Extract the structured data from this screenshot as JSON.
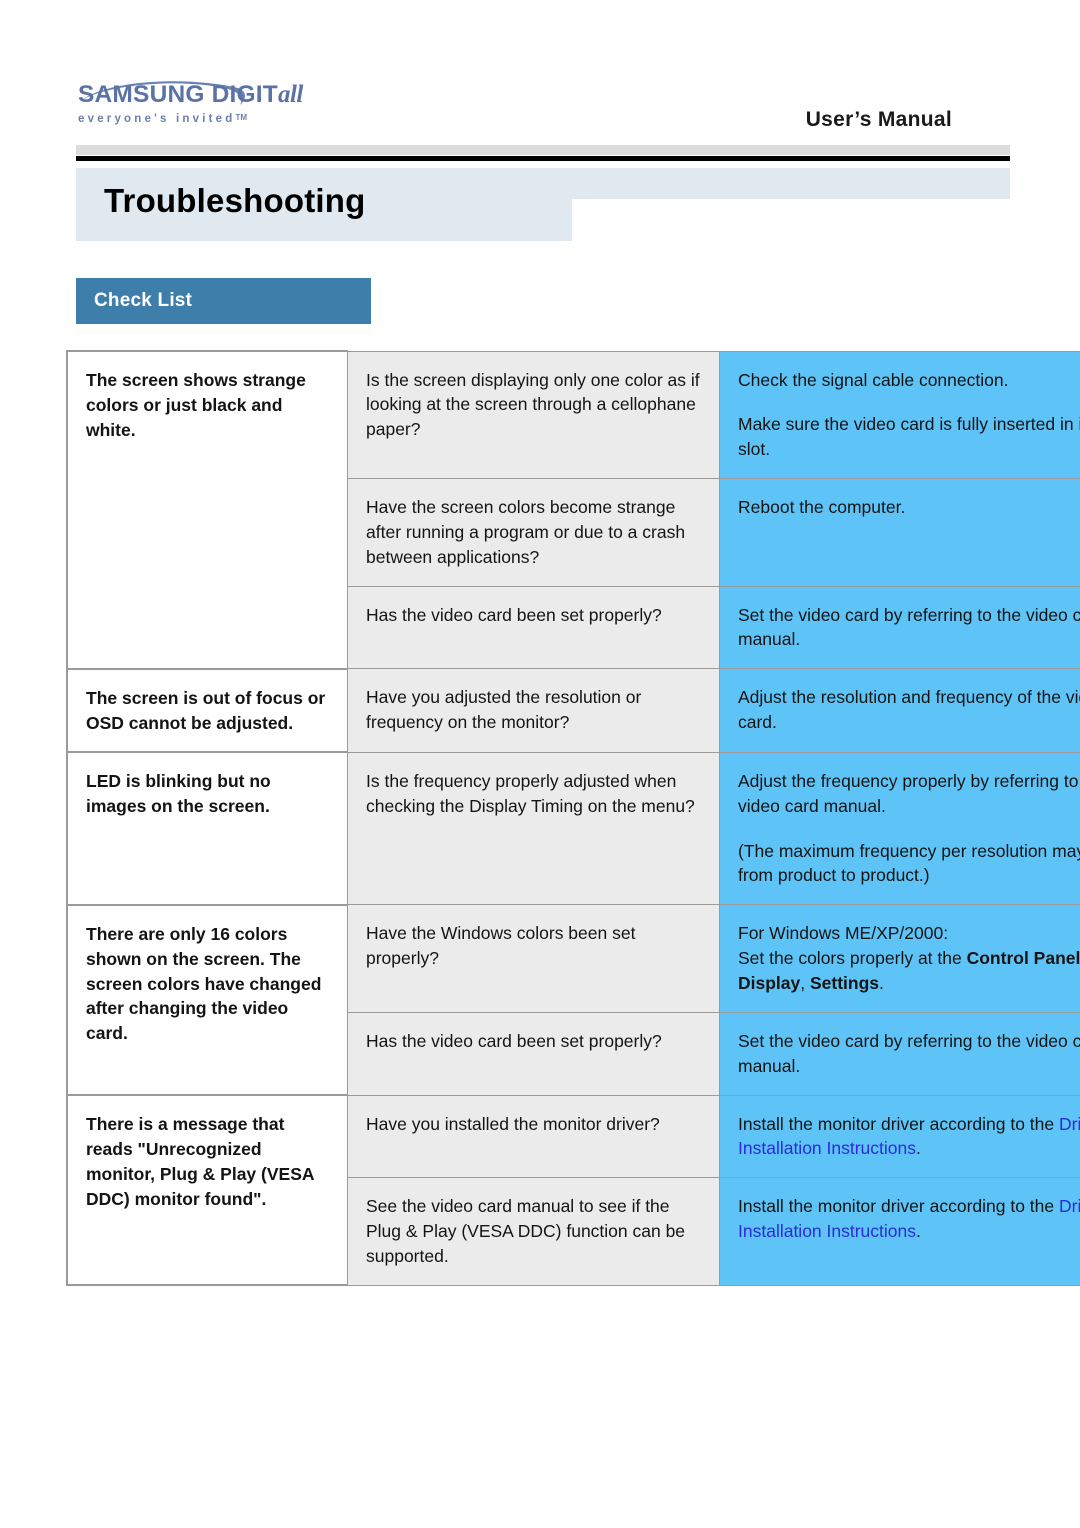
{
  "header": {
    "logo_wordmark_samsung": "SAMSUNG DIGIT",
    "logo_wordmark_all": "all",
    "logo_tagline": "everyone's invited",
    "logo_tagline_tm": "TM",
    "document_label": "User’s Manual"
  },
  "title": {
    "text": "Troubleshooting"
  },
  "section": {
    "tab_label": "Check List"
  },
  "colors": {
    "tab_blue": "#3d7faa",
    "fix_cell_blue": "#5ec4f7",
    "check_cell_grey": "#ebebeb",
    "title_band": "#dfe9ef",
    "link_blue": "#2b2bdd",
    "logo_blue": "#5b72a6"
  },
  "table": {
    "groups": [
      {
        "symptom": "The screen shows strange colors or just black and white.",
        "rows": [
          {
            "check": "Is the screen displaying only one color as if looking at the screen through a cellophane paper?",
            "fix_paragraphs": [
              "Check the signal cable connection.",
              "Make sure the video card is fully inserted in it's slot."
            ]
          },
          {
            "check": "Have the screen colors become strange after running a program or due to a crash between applications?",
            "fix_paragraphs": [
              "Reboot the computer."
            ]
          },
          {
            "check": "Has the video card been set properly?",
            "fix_paragraphs": [
              "Set the video card by referring to the video card manual."
            ]
          }
        ]
      },
      {
        "symptom": "The screen is out of focus or OSD cannot be adjusted.",
        "rows": [
          {
            "check": "Have you adjusted the resolution or frequency on the monitor?",
            "fix_paragraphs": [
              "Adjust the resolution and frequency of the video card."
            ]
          }
        ]
      },
      {
        "symptom": "LED is blinking but no images on the screen.",
        "rows": [
          {
            "check": "Is the frequency properly adjusted when checking the Display Timing on the menu?",
            "fix_paragraphs": [
              "Adjust the frequency properly by referring to the video card manual.",
              "(The maximum frequency per resolution may differ from product to product.)"
            ]
          }
        ]
      },
      {
        "symptom": "There are only 16 colors shown on the screen. The screen colors have changed after changing the video card.",
        "rows": [
          {
            "check": "Have the Windows colors been set properly?",
            "fix_rich": {
              "line1": "For Windows ME/XP/2000:",
              "line2_pre": "Set the colors properly at the ",
              "line2_bold1": "Control Panel",
              "line2_sep1": ", ",
              "line2_bold2": "Display",
              "line2_sep2": ", ",
              "line2_bold3": "Settings",
              "line2_post": "."
            }
          },
          {
            "check": "Has the video card been set properly?",
            "fix_paragraphs": [
              "Set the video card by referring to the video card manual."
            ]
          }
        ]
      },
      {
        "symptom": "There is a message that reads \"Unrecognized monitor, Plug & Play (VESA DDC) monitor found\".",
        "rows": [
          {
            "check": "Have you installed the monitor driver?",
            "fix_link": {
              "pre": "Install the monitor driver according to the ",
              "link": "Driver Installation Instructions",
              "post": "."
            }
          },
          {
            "check": "See the video card manual to see if the Plug & Play (VESA DDC) function can be supported.",
            "fix_link": {
              "pre": "Install the monitor driver according to the ",
              "link": "Driver Installation Instructions",
              "post": "."
            }
          }
        ]
      }
    ]
  }
}
